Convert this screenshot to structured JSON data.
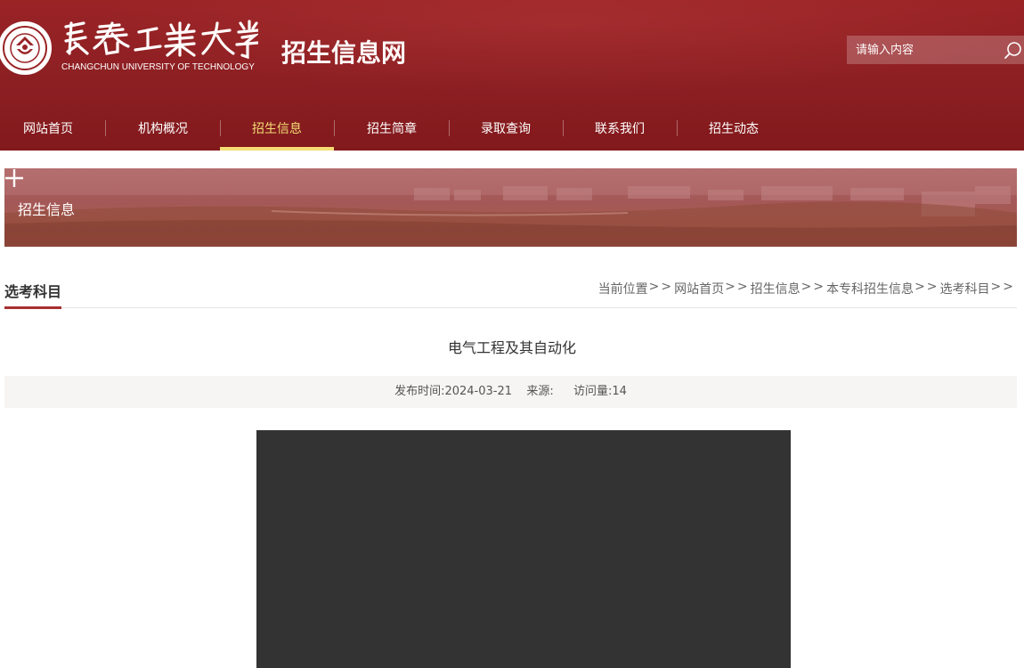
{
  "header": {
    "logo_cn": "長春工業大學",
    "logo_en": "CHANGCHUN UNIVERSITY OF TECHNOLOGY",
    "site_title": "招生信息网",
    "search": {
      "placeholder": "请输入内容",
      "icon": "search-icon"
    }
  },
  "nav": {
    "items": [
      {
        "label": "网站首页",
        "active": false
      },
      {
        "label": "机构概况",
        "active": false
      },
      {
        "label": "招生信息",
        "active": true
      },
      {
        "label": "招生简章",
        "active": false
      },
      {
        "label": "录取查询",
        "active": false
      },
      {
        "label": "联系我们",
        "active": false
      },
      {
        "label": "招生动态",
        "active": false
      }
    ]
  },
  "banner": {
    "title": "招生信息",
    "icon": "plus-icon"
  },
  "section": {
    "title": "选考科目",
    "breadcrumb": {
      "prefix": "当前位置",
      "separator": ">>",
      "items": [
        "网站首页",
        "招生信息",
        "本专科招生信息",
        "选考科目"
      ]
    }
  },
  "article": {
    "title": "电气工程及其自动化",
    "meta": {
      "publish_label": "发布时间:",
      "publish_date": "2024-03-21",
      "source_label": "来源:",
      "source_value": "",
      "views_label": "访问量:",
      "views": "14"
    }
  },
  "colors": {
    "header_red": "#8c1f22",
    "nav_active": "#f3dd74",
    "accent_underline": "#a92f31",
    "video_bg": "#333333"
  }
}
